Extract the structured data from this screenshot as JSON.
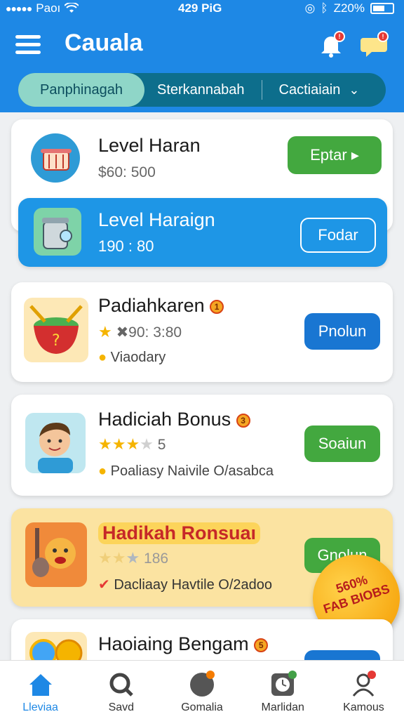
{
  "status": {
    "carrier": "Paoı",
    "time": "429 PiG",
    "battery": "Z20%"
  },
  "app": {
    "title": "Cauala",
    "notifications_badge": "!",
    "messages_badge": "!"
  },
  "tabs": [
    {
      "label": "Panphinagah"
    },
    {
      "label": "Sterkannabah"
    },
    {
      "label": "Cactiaiain"
    }
  ],
  "cards": [
    {
      "title": "Level Haran",
      "sub": "$60: 500",
      "button": "Eptar ▸",
      "icon": "cooking-pot-icon"
    },
    {
      "title": "Level Haraign",
      "sub": "190 : 80",
      "button": "Fodar",
      "icon": "blender-icon"
    },
    {
      "title": "Padiahkaren",
      "badge": "1",
      "rating_text": "✖90: 3:80",
      "sub": "Viaodary",
      "button": "Pnolun",
      "icon": "treasure-pot-icon"
    },
    {
      "title": "Hadiciah Bonus",
      "badge": "3",
      "rating_text": "5",
      "sub": "Poaliasy Naivile O/asabca",
      "button": "Soaiun",
      "icon": "boy-avatar-icon"
    },
    {
      "title": "Hadikah Ronsuaı",
      "rating_text": "186",
      "sub": "Dacliaay Havtile O/2adoo",
      "button": "Gnolun",
      "icon": "guitar-character-icon",
      "promo": "560%\nFAB BIOBS"
    },
    {
      "title": "Haoiaing Bengam",
      "badge": "5",
      "icon": "coins-icon"
    }
  ],
  "nav": [
    {
      "label": "Lleviaa",
      "icon": "home-icon"
    },
    {
      "label": "Savd",
      "icon": "search-icon"
    },
    {
      "label": "Gomalia",
      "icon": "compass-icon"
    },
    {
      "label": "Marlidan",
      "icon": "clock-icon"
    },
    {
      "label": "Kamous",
      "icon": "profile-icon"
    }
  ],
  "colors": {
    "primary": "#1e88e5",
    "green": "#43a83f",
    "highlight_card": "#fbe3a1",
    "tab_bar": "#0d6e8c"
  }
}
